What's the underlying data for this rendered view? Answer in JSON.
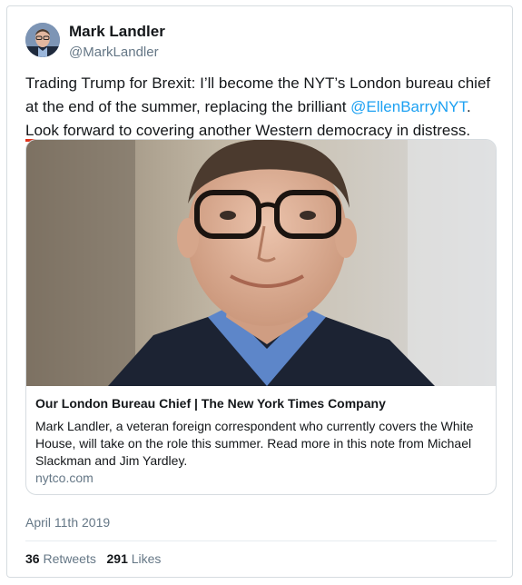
{
  "author": {
    "name": "Mark Landler",
    "handle": "@MarkLandler"
  },
  "tweet": {
    "text_part1": "Trading Trump for Brexit: I’ll become the NYT’s London bureau chief at the end of the summer, replacing the brilliant ",
    "mention": "@EllenBarryNYT",
    "text_part2": ". ",
    "highlighted_text": "Look forward to covering another Western democracy in distress",
    "text_part3": "."
  },
  "card": {
    "title": "Our London Bureau Chief | The New York Times Company",
    "description": "Mark Landler, a veteran foreign correspondent who currently covers the White House, will take on the role this summer. Read more in this note from Michael Slackman and Jim Yardley.",
    "domain": "nytco.com"
  },
  "date": "April 11th 2019",
  "stats": {
    "retweets_count": "36",
    "retweets_label": "Retweets",
    "likes_count": "291",
    "likes_label": "Likes"
  },
  "colors": {
    "link": "#1da1f2",
    "highlight_underline": "#e0341d",
    "secondary_text": "#657786"
  }
}
